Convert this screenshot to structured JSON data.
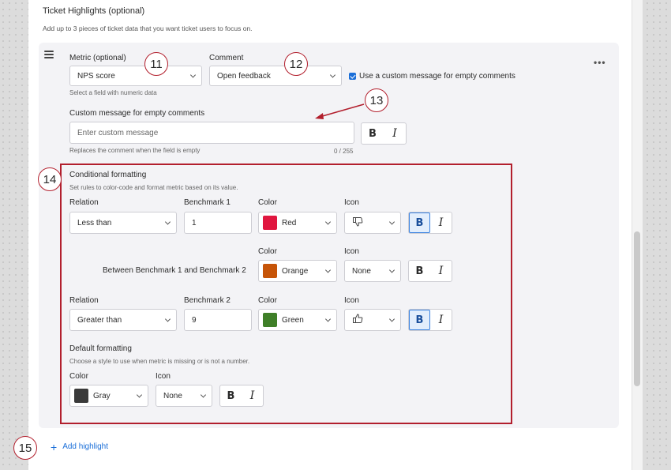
{
  "section": {
    "title": "Ticket Highlights (optional)",
    "subtitle": "Add up to 3 pieces of ticket data that you want ticket users to focus on."
  },
  "metric": {
    "label": "Metric (optional)",
    "value": "NPS score",
    "hint": "Select a field with numeric data"
  },
  "comment": {
    "label": "Comment",
    "value": "Open feedback",
    "checkbox_label": "Use a custom message for empty comments",
    "checked": true
  },
  "custom_message": {
    "label": "Custom message for empty comments",
    "placeholder": "Enter custom message",
    "hint": "Replaces the comment when the field is empty",
    "counter": "0 / 255"
  },
  "format_buttons": {
    "bold": "B",
    "italic": "I"
  },
  "conditional": {
    "title": "Conditional formatting",
    "subtitle": "Set rules to color-code and format metric based on its value.",
    "labels": {
      "relation": "Relation",
      "benchmark1": "Benchmark 1",
      "benchmark2": "Benchmark 2",
      "color": "Color",
      "icon": "Icon"
    },
    "row1": {
      "relation": "Less than",
      "benchmark": "1",
      "color_name": "Red",
      "color_hex": "#e0163f",
      "icon": "thumbs-down-icon",
      "bold_active": true
    },
    "row2": {
      "between_label": "Between Benchmark 1 and Benchmark 2",
      "color_name": "Orange",
      "color_hex": "#c65408",
      "icon": "None",
      "bold_active": false
    },
    "row3": {
      "relation": "Greater than",
      "benchmark": "9",
      "color_name": "Green",
      "color_hex": "#3f7f28",
      "icon": "thumbs-up-icon",
      "bold_active": true
    }
  },
  "default_formatting": {
    "title": "Default formatting",
    "subtitle": "Choose a style to use when metric is missing or is not a number.",
    "color_label": "Color",
    "icon_label": "Icon",
    "color_name": "Gray",
    "color_hex": "#3a3a3a",
    "icon": "None"
  },
  "add_highlight": {
    "label": "Add highlight"
  },
  "callouts": {
    "c11": "11",
    "c12": "12",
    "c13": "13",
    "c14": "14",
    "c15": "15"
  },
  "colors": {
    "accent": "#1a6ed8",
    "callout_red": "#b21f2d"
  }
}
